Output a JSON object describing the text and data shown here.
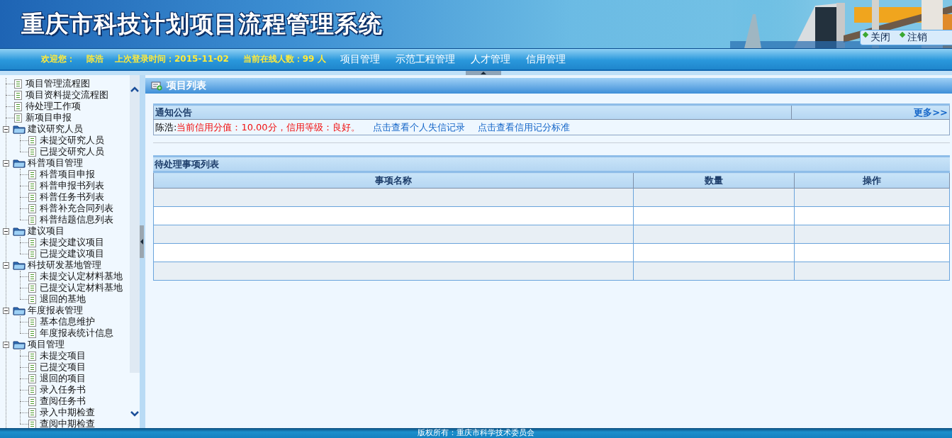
{
  "header": {
    "title": "重庆市科技计划项目流程管理系统",
    "actions": [
      {
        "label": "关闭"
      },
      {
        "label": "注销"
      }
    ]
  },
  "user_bar": {
    "welcome_label": "欢迎您：",
    "user_name": "陈浩",
    "last_login": "上次登录时间：2015-11-02",
    "online": "当前在线人数：99 人"
  },
  "nav_menu": [
    {
      "label": "项目管理"
    },
    {
      "label": "示范工程管理"
    },
    {
      "label": "人才管理"
    },
    {
      "label": "信用管理"
    }
  ],
  "sidebar": {
    "items": [
      {
        "kind": "leaf",
        "label": "项目管理流程图"
      },
      {
        "kind": "leaf",
        "label": "项目资料提交流程图"
      },
      {
        "kind": "leaf",
        "label": "待处理工作项"
      },
      {
        "kind": "leaf",
        "label": "新项目申报"
      },
      {
        "kind": "folder",
        "label": "建议研究人员",
        "expanded": true,
        "children": [
          {
            "kind": "leaf",
            "label": "未提交研究人员"
          },
          {
            "kind": "leaf",
            "label": "已提交研究人员"
          }
        ]
      },
      {
        "kind": "folder",
        "label": "科普项目管理",
        "expanded": true,
        "children": [
          {
            "kind": "leaf",
            "label": "科普项目申报"
          },
          {
            "kind": "leaf",
            "label": "科普申报书列表"
          },
          {
            "kind": "leaf",
            "label": "科普任务书列表"
          },
          {
            "kind": "leaf",
            "label": "科普补充合同列表"
          },
          {
            "kind": "leaf",
            "label": "科普结题信息列表"
          }
        ]
      },
      {
        "kind": "folder",
        "label": "建议项目",
        "expanded": true,
        "children": [
          {
            "kind": "leaf",
            "label": "未提交建议项目"
          },
          {
            "kind": "leaf",
            "label": "已提交建议项目"
          }
        ]
      },
      {
        "kind": "folder",
        "label": "科技研发基地管理",
        "expanded": true,
        "children": [
          {
            "kind": "leaf",
            "label": "未提交认定材料基地"
          },
          {
            "kind": "leaf",
            "label": "已提交认定材料基地"
          },
          {
            "kind": "leaf",
            "label": "退回的基地"
          }
        ]
      },
      {
        "kind": "folder",
        "label": "年度报表管理",
        "expanded": true,
        "children": [
          {
            "kind": "leaf",
            "label": "基本信息维护"
          },
          {
            "kind": "leaf",
            "label": "年度报表统计信息"
          }
        ]
      },
      {
        "kind": "folder",
        "label": "项目管理",
        "expanded": true,
        "children": [
          {
            "kind": "leaf",
            "label": "未提交项目"
          },
          {
            "kind": "leaf",
            "label": "已提交项目"
          },
          {
            "kind": "leaf",
            "label": "退回的项目"
          },
          {
            "kind": "leaf",
            "label": "录入任务书"
          },
          {
            "kind": "leaf",
            "label": "查阅任务书"
          },
          {
            "kind": "leaf",
            "label": "录入中期检查"
          },
          {
            "kind": "leaf",
            "label": "查阅中期检查"
          }
        ]
      }
    ]
  },
  "panel": {
    "title": "项目列表"
  },
  "notice": {
    "title": "通知公告",
    "more": "更多>>",
    "name": "陈浩:",
    "credit": "当前信用分值：10.00分，信用等级：良好。",
    "links": [
      "点击查看个人失信记录",
      "点击查看信用记分标准"
    ]
  },
  "pending": {
    "title": "待处理事项列表",
    "columns": [
      "事项名称",
      "数量",
      "操作"
    ]
  },
  "footer": {
    "text": "版权所有：重庆市科学技术委员会"
  }
}
